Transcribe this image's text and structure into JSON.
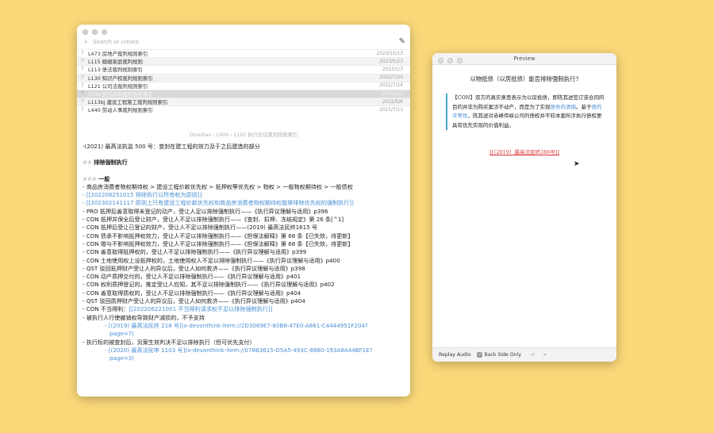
{
  "notes": {
    "search": {
      "placeholder": "Search or create"
    },
    "list": [
      {
        "title": "L473 房地产裁判规则索引",
        "date": "2023/10/13"
      },
      {
        "title": "L115 婚姻家庭裁判规则",
        "date": "2023/5/23"
      },
      {
        "title": "L113 债法裁判规则索引",
        "date": "2023/1/3"
      },
      {
        "title": "L130 知识产权裁判规则索引",
        "date": "2022/7/20"
      },
      {
        "title": "L121 公司法裁判规则索引",
        "date": "2022/7/14"
      },
      {
        "title": "L109 执行异议裁判规则索引",
        "date": "2022/5/1"
      },
      {
        "title": "L113bj 建设工程施工裁判规则索引",
        "date": "2022/5/6"
      },
      {
        "title": "L440 劳动人事裁判规则索引",
        "date": "2021/7/13"
      }
    ],
    "breadcrumb": "Obsidian › L000 › L192 执行异议裁判规则索引",
    "editor": {
      "l1": "-(2021) 最高法执监 500 号：查封在建工程的效力及于之后建造的部分",
      "h2mark": "##",
      "h2": "排除强制执行",
      "h3mark": "###",
      "h3": "一般",
      "l2": "- 商品房消费者物权期待权 > 建设工程价款优先权 > 抵押权等优先权 > 物权 > 一般物权期待权 > 一般债权",
      "l3": "- [[202208251015 排除执行以所有权为原则]]",
      "l4": "- [[202302141117 原则上只有建设工程价款优先权和商品房消费者物权期待权能够排除优先权的强制执行]]",
      "l5": "- PRO 抵押后善意取得未登记的动产，受让人足以排除强制执行——《执行异议理解与适用》p396",
      "l6": "- CON 抵押并保全后受让财产，受让人不足以排除强制执行——《查封、扣押、冻结规定》第 26 条[^1]",
      "l7": "- CON 抵押后受让已登记的财产，受让人不足以排除强制执行——(2019) 最高法民终1615 号",
      "l8": "- CON 债承不影响抵押权效力，受让人不足以排除强制执行——《担保法解释》第 68 条【已失效，待更新】",
      "l9": "- CON 赠与不影响抵押权效力，受让人不足以排除强制执行——《担保法解释》第 68 条【已失效，待更新】",
      "l10": "- CON 善意取得抵押权的，受让人不足以排除强制执行——《执行异议理解与适用》p399",
      "l11": "- CON 土地使用权上设抵押权的，土地使用权人不足以排除强制执行——《执行异议理解与适用》p400",
      "l12": "- QST 驳回抵押财产受让人的异议后，受让人如何救济——《执行异议理解与适用》p398",
      "l13": "- CON 动产质押交付的，受让人不足以排除强制执行——《执行异议理解与适用》p401",
      "l14": "- CON 权利质押登记的，推定受让人应知，其不足以排除强制执行——《执行异议理解与适用》p402",
      "l15": "- CON 善意取得质权的，受让人不足以排除强制执行——《执行异议理解与适用》p404",
      "l16": "- QST 驳回质押财产受让人的异议后，受让人如何救济——《执行异议理解与适用》p404",
      "l17a": "- CON 不当得利：",
      "l17b": "[[202206221001 不当得利请求权不足以排除强制执行]]",
      "l18": "- 被执行人行使撤销权导致财产减损的，不予支持",
      "l19a": "- [(2019) 最高法民终 218 号]",
      "l19b": "(x-devonthink-item://2D3069E7-80B6-47E0-A861-C4444951F204?",
      "l19c": "page=7)",
      "l20": "- 执行标的被查封后，另案生效判决不足以排除执行（但可优先支付）",
      "l21a": "- [(2020) 最高法民申 1103 号]",
      "l21b": "(x-devonthink-item://078B3615-D5A5-493C-8880-193A8A44BF1E?",
      "l21c": "page=3)"
    }
  },
  "preview": {
    "title": "Preview",
    "question": "以物抵债（以房抵债）能否排除强制执行?",
    "answer_p1": "【CON】双方的真实意思表示为以房抵债，即陈其述签订该合同的目的并非为购买案涉不动产，而是为了实现",
    "answer_link1": "债务的清偿",
    "answer_p2": "。基于",
    "answer_link2": "债的平等性",
    "answer_p3": "，陈其述对赤峰伟峡公司的债权并不较本案所涉执行债权更具有优先实现的价值利益。",
    "reference": "[[（2019）最高法民终286号]]",
    "replay": "Replay Audio",
    "backside": "Back Side Only",
    "prev": "<",
    "next": ">"
  },
  "colors": {
    "background": "#fbd97a",
    "link": "#4a8fd6",
    "accent_border": "#4aa5c9",
    "reference": "#dd3333"
  }
}
